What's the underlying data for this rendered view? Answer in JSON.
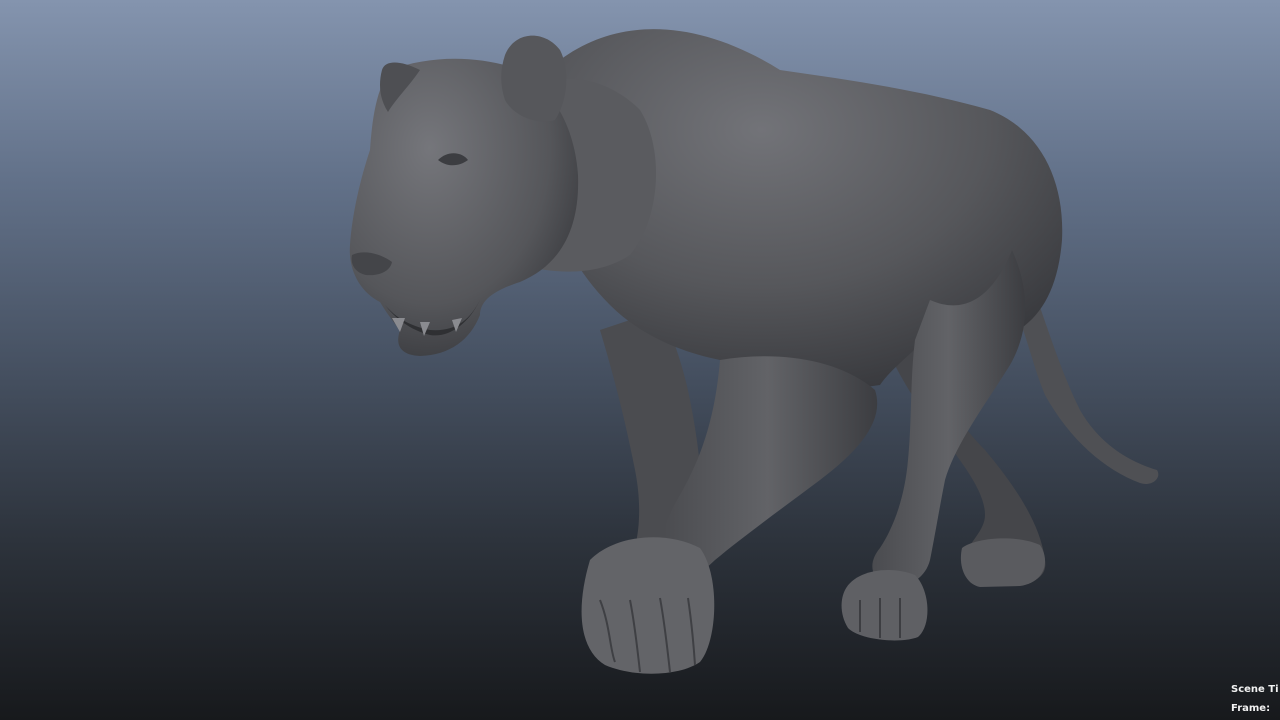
{
  "viewport": {
    "background_top": "#8494ae",
    "background_bottom": "#17191c",
    "model_color": "#5b5c60",
    "model_shadow": "#2f3033",
    "model_highlight": "#7a7b80"
  },
  "hud": {
    "scene_time_label": "Scene Ti",
    "frame_label": "Frame:"
  },
  "icons": {
    "model": "panther-model-icon"
  }
}
